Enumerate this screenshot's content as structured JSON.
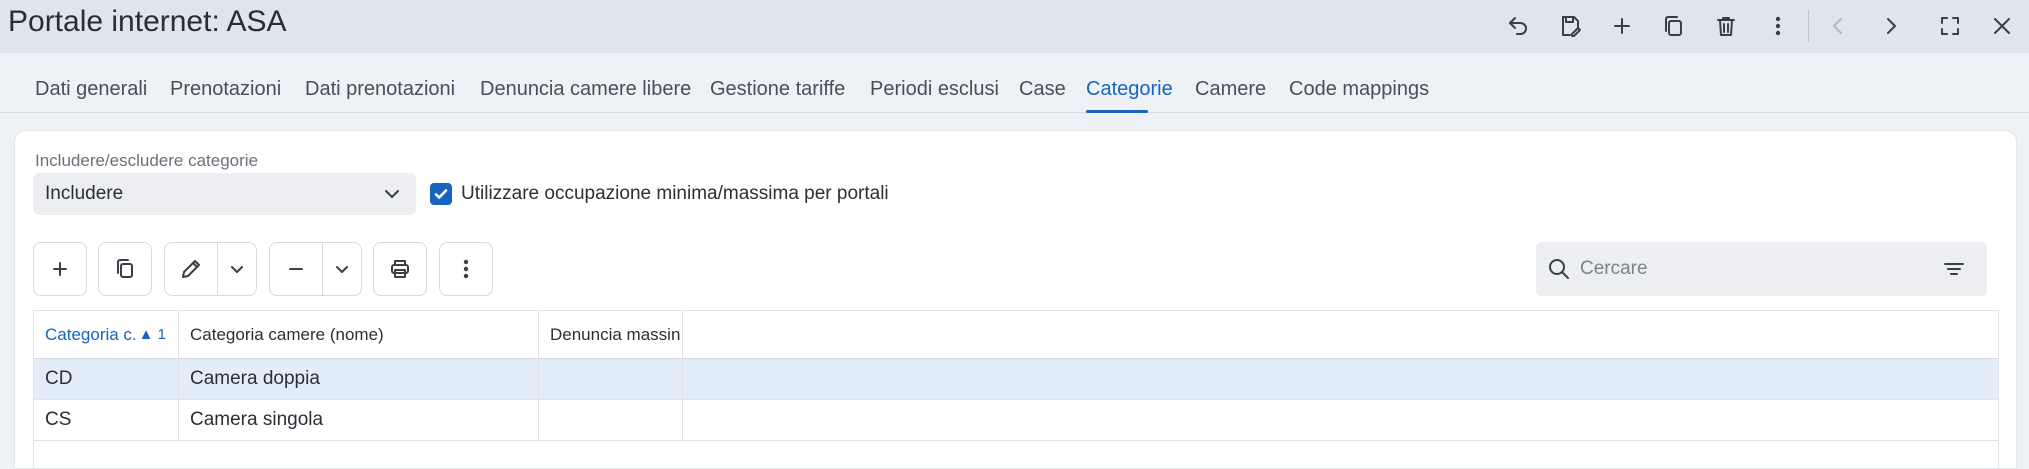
{
  "window": {
    "title": "Portale internet: ASA"
  },
  "tabs": [
    {
      "label": "Dati generali"
    },
    {
      "label": "Prenotazioni"
    },
    {
      "label": "Dati prenotazioni"
    },
    {
      "label": "Denuncia camere libere"
    },
    {
      "label": "Gestione tariffe"
    },
    {
      "label": "Periodi esclusi"
    },
    {
      "label": "Case"
    },
    {
      "label": "Categorie",
      "active": true
    },
    {
      "label": "Camere"
    },
    {
      "label": "Code mappings"
    }
  ],
  "form": {
    "include_label": "Includere/escludere categorie",
    "include_value": "Includere",
    "occupancy_checkbox_label": "Utilizzare occupazione minima/massima per portali",
    "occupancy_checked": true
  },
  "search": {
    "placeholder": "Cercare"
  },
  "table": {
    "columns": [
      {
        "label": "Categoria c.",
        "sort": "▲ 1"
      },
      {
        "label": "Categoria camere (nome)"
      },
      {
        "label": "Denuncia massin"
      }
    ],
    "rows": [
      {
        "code": "CD",
        "name": "Camera doppia",
        "report": "",
        "selected": true
      },
      {
        "code": "CS",
        "name": "Camera singola",
        "report": ""
      }
    ]
  },
  "colors": {
    "accent": "#1565c0",
    "selected_row": "#e3edf9",
    "titlebar": "#dfe5ed"
  },
  "icons": [
    "undo-icon",
    "save-icon",
    "add-icon",
    "copy-icon",
    "delete-icon",
    "more-vertical-icon",
    "chevron-left-icon",
    "chevron-right-icon",
    "fullscreen-icon",
    "close-icon",
    "edit-icon",
    "minus-icon",
    "print-icon",
    "search-icon",
    "filter-icon"
  ]
}
